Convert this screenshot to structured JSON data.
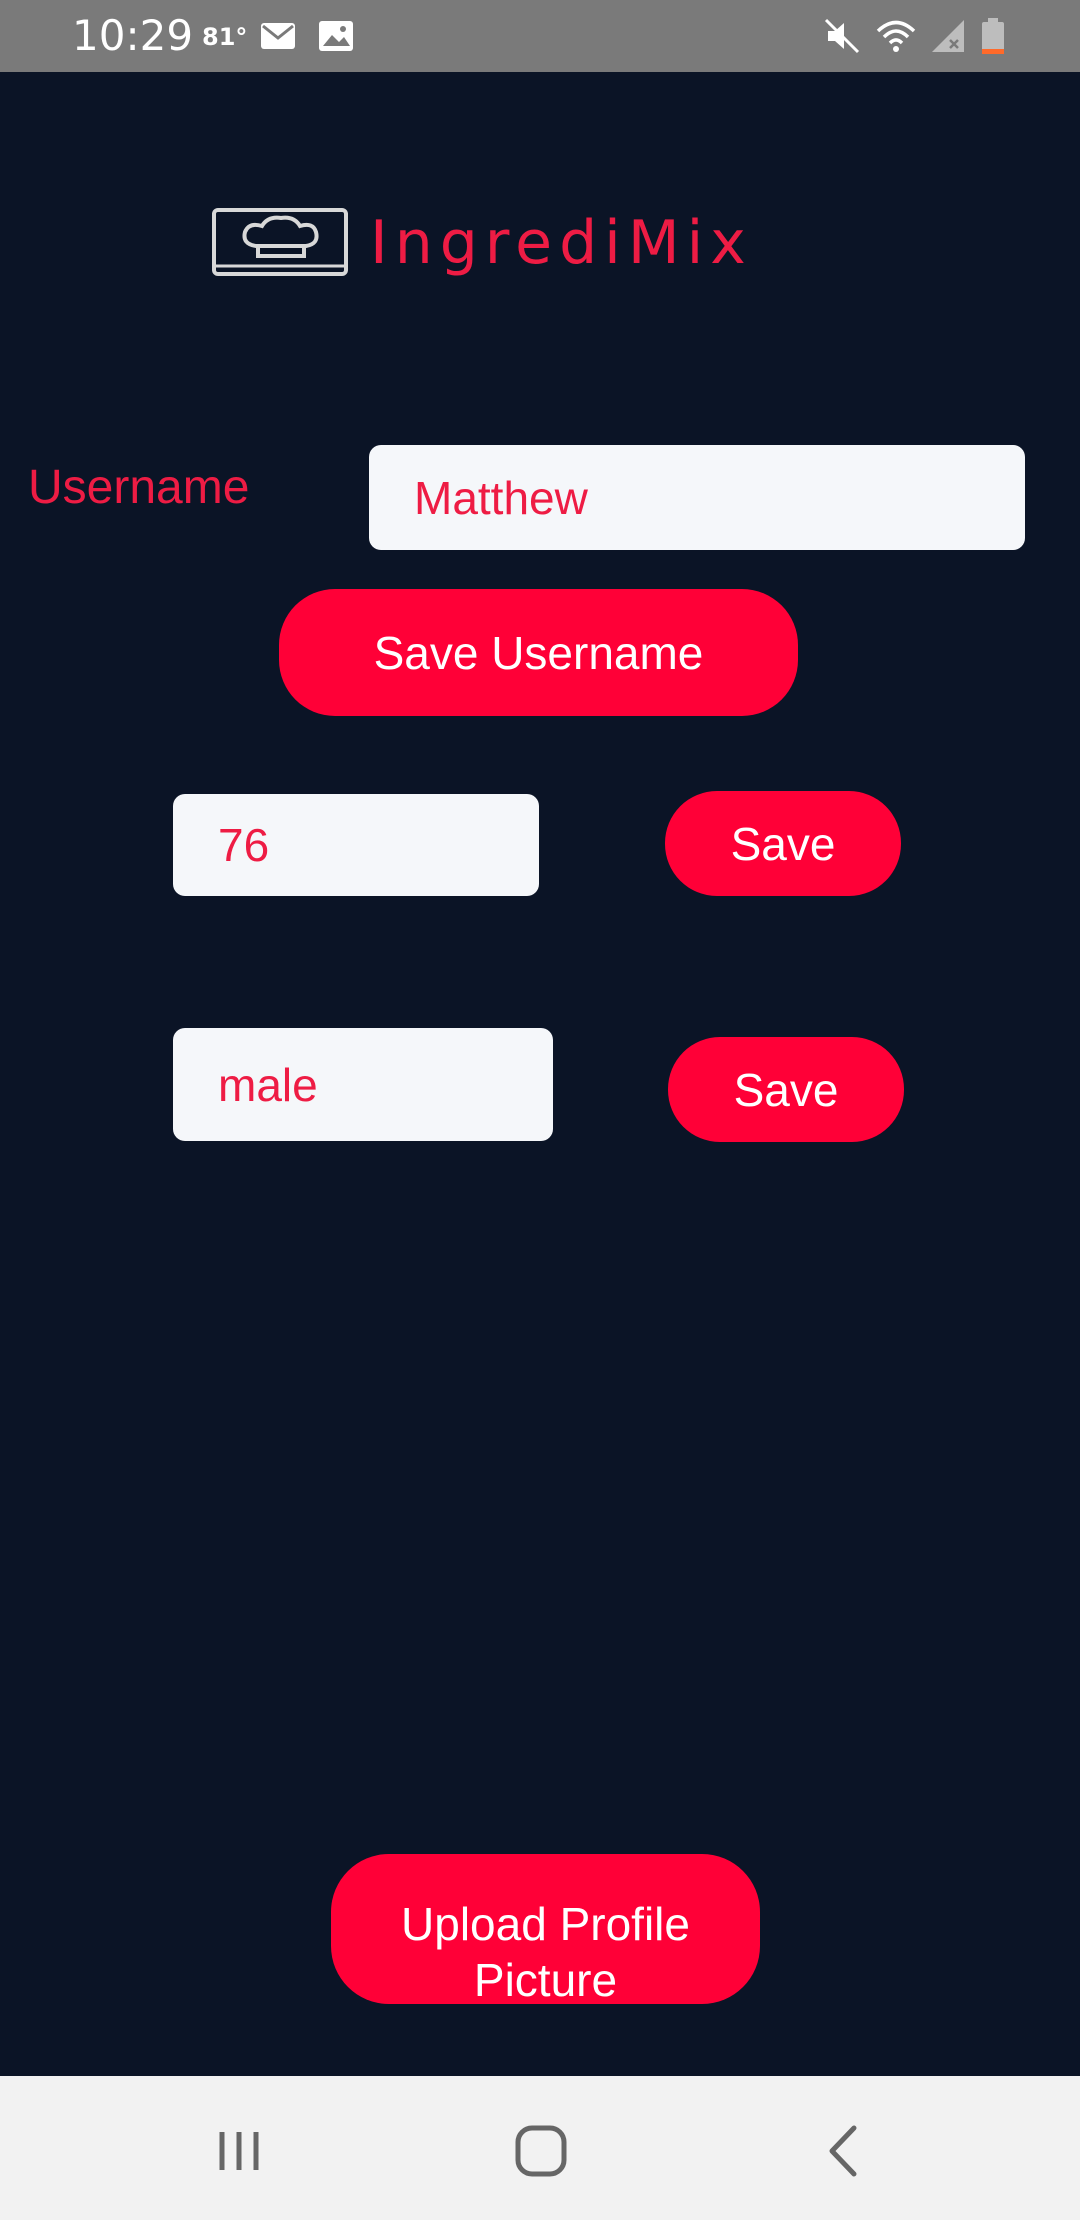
{
  "status_bar": {
    "time": "10:29",
    "temperature": "81°",
    "icons": [
      "mail-icon",
      "image-icon",
      "mute-icon",
      "wifi-icon",
      "signal-icon",
      "battery-icon"
    ]
  },
  "app": {
    "name": "IngrediMix",
    "logo_icon": "chef-hat-icon"
  },
  "form": {
    "username_label": "Username",
    "username_value": "Matthew",
    "save_username_label": "Save Username",
    "age_value": "76",
    "age_save_label": "Save",
    "gender_value": "male",
    "gender_save_label": "Save",
    "upload_label_line1": "Upload Profile",
    "upload_label_line2": "Picture"
  },
  "nav_bar": {
    "icons": [
      "recent-apps-icon",
      "home-icon",
      "back-icon"
    ]
  },
  "colors": {
    "background": "#0b1426",
    "accent": "#ff0037",
    "text_accent": "#ee1c44",
    "input_background": "#f5f7fa"
  }
}
